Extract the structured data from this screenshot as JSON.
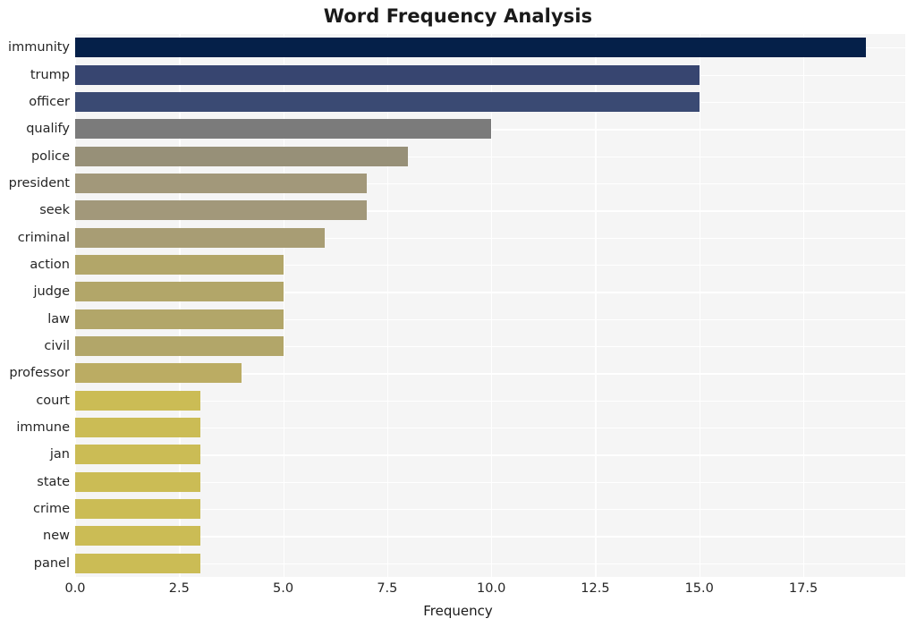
{
  "chart_data": {
    "type": "bar",
    "orientation": "horizontal",
    "title": "Word Frequency Analysis",
    "xlabel": "Frequency",
    "ylabel": "",
    "xlim": [
      0,
      19.95
    ],
    "xticks": [
      0.0,
      2.5,
      5.0,
      7.5,
      10.0,
      12.5,
      15.0,
      17.5
    ],
    "xticklabels": [
      "0.0",
      "2.5",
      "5.0",
      "7.5",
      "10.0",
      "12.5",
      "15.0",
      "17.5"
    ],
    "grid": true,
    "legend": null,
    "categories": [
      "immunity",
      "trump",
      "officer",
      "qualify",
      "police",
      "president",
      "seek",
      "criminal",
      "action",
      "judge",
      "law",
      "civil",
      "professor",
      "court",
      "immune",
      "jan",
      "state",
      "crime",
      "new",
      "panel"
    ],
    "values": [
      19,
      15,
      15,
      10,
      8,
      7,
      7,
      6,
      5,
      5,
      5,
      5,
      4,
      3,
      3,
      3,
      3,
      3,
      3,
      3
    ],
    "bar_colors": [
      "#052049",
      "#374straw",
      "#3a4a73",
      "#7b7b7b",
      "#979078",
      "#a2987a",
      "#a2987a",
      "#a89d74",
      "#b2a669",
      "#b2a669",
      "#b2a669",
      "#b2a669",
      "#bbac63",
      "#cbbc55",
      "#cbbc55",
      "#cbbc55",
      "#cbbc55",
      "#cbbc55",
      "#cbbc55",
      "#cbbc55"
    ],
    "palette_name": "cividis-like",
    "background_color": "#f5f5f5",
    "figure_background": "#ffffff",
    "gridline_color": "#ffffff"
  }
}
